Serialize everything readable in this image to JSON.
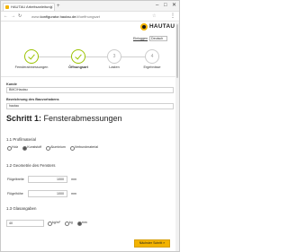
{
  "browser": {
    "tab_title": "HAUTAU Arbeitsanleitung",
    "url_prefix": "www.",
    "url_domain": "konfigurator.hautau.de",
    "url_path": "/#/oeffnungsart"
  },
  "brand": {
    "name": "HAUTAU",
    "accent_color": "#f3b300"
  },
  "header": {
    "links_label": "Einloggen",
    "language_value": "Deutsch"
  },
  "stepper": {
    "steps": [
      {
        "label": "Fensterabmessungen",
        "status": "done",
        "number": "1"
      },
      {
        "label": "Öffnungsart",
        "status": "done",
        "number": "2"
      },
      {
        "label": "Lasten",
        "status": "todo",
        "number": "3"
      },
      {
        "label": "Ergebnisse",
        "status": "todo",
        "number": "4"
      }
    ],
    "active_color": "#9bc300"
  },
  "form": {
    "kunde_label": "Kunde",
    "kunde_value": "BMC/Hautau",
    "bauvorhaben_label": "Bezeichnung des Bauvorhabens",
    "bauvorhaben_value": "hautau"
  },
  "section": {
    "title_prefix": "Schritt 1:",
    "title_text": " Fensterabmessungen",
    "profil_heading": "1.1 Profilmaterial",
    "profil_options": [
      "Holz",
      "Kunststoff",
      "Aluminium",
      "Verbundmaterial"
    ],
    "profil_selected": "Kunststoff",
    "geometrie_heading": "1.2 Geometrie des Fensters",
    "fluegelbreite_label": "Flügelbreite",
    "fluegelbreite_value": "1000",
    "fluegelhoehe_label": "Flügelhöhe",
    "fluegelhoehe_value": "1000",
    "unit": "mm",
    "glas_heading": "1.3 Glasangaben",
    "glas_value": "40",
    "glas_options": [
      "kg/m²",
      "kg",
      "mm"
    ],
    "glas_selected": "mm"
  },
  "footer": {
    "next_label": "Nächster Schritt »"
  }
}
